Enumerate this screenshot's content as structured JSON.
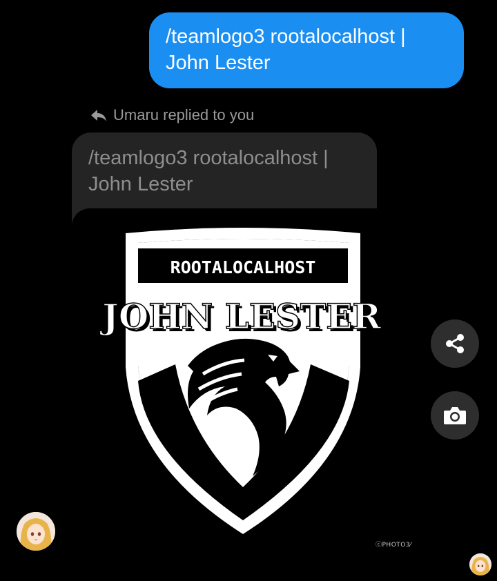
{
  "sent_message": {
    "text": "/teamlogo3 rootalocalhost |\nJohn Lester"
  },
  "reply_header": {
    "icon": "reply-icon",
    "text": "Umaru replied to you"
  },
  "quoted_message": {
    "text": "/teamlogo3 rootalocalhost |\nJohn Lester"
  },
  "logo_image": {
    "banner_text": "ROOTALOCALHOST",
    "name_text": "JOHN LESTER",
    "watermark": "ⓒPHOTO3⁄"
  },
  "actions": {
    "share_icon": "share-icon",
    "camera_icon": "camera-icon"
  },
  "colors": {
    "sent_bubble": "#1b8ef2",
    "quoted_bubble": "#242424",
    "action_button": "#2e2e2e"
  }
}
